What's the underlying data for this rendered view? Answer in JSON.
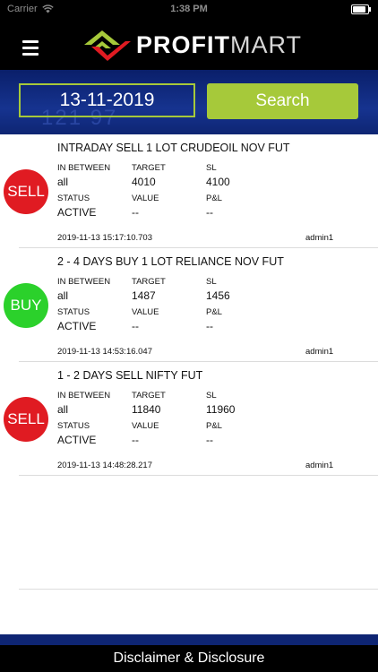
{
  "status_bar": {
    "carrier": "Carrier",
    "time": "1:38 PM",
    "battery_level": 0.9
  },
  "header": {
    "logo": {
      "word_bold": "PROFIT",
      "word_light": "MART"
    }
  },
  "search": {
    "date_value": "13-11-2019",
    "button_label": "Search",
    "background_digits": "121 97"
  },
  "colors": {
    "accent_green": "#a6c93a",
    "sell_red": "#e01b22",
    "buy_green": "#2bd12b",
    "band_blue": "#16338f"
  },
  "calls": [
    {
      "side": "SELL",
      "side_color": "#e01b22",
      "title": "INTRADAY SELL 1 LOT CRUDEOIL NOV FUT",
      "labels": {
        "in_between": "IN BETWEEN",
        "target": "TARGET",
        "sl": "SL",
        "status": "STATUS",
        "value": "VALUE",
        "pnl": "P&L"
      },
      "in_between": "all",
      "target": "4010",
      "sl": "4100",
      "status": "ACTIVE",
      "value": "--",
      "pnl": "--",
      "timestamp": "2019-11-13 15:17:10.703",
      "author": "admin1"
    },
    {
      "side": "BUY",
      "side_color": "#2bd12b",
      "title": "2 - 4 DAYS BUY 1 LOT RELIANCE NOV FUT",
      "labels": {
        "in_between": "IN BETWEEN",
        "target": "TARGET",
        "sl": "SL",
        "status": "STATUS",
        "value": "VALUE",
        "pnl": "P&L"
      },
      "in_between": "all",
      "target": "1487",
      "sl": "1456",
      "status": "ACTIVE",
      "value": "--",
      "pnl": "--",
      "timestamp": "2019-11-13 14:53:16.047",
      "author": "admin1"
    },
    {
      "side": "SELL",
      "side_color": "#e01b22",
      "title": "1 - 2 DAYS SELL NIFTY FUT",
      "labels": {
        "in_between": "IN BETWEEN",
        "target": "TARGET",
        "sl": "SL",
        "status": "STATUS",
        "value": "VALUE",
        "pnl": "P&L"
      },
      "in_between": "all",
      "target": "11840",
      "sl": "11960",
      "status": "ACTIVE",
      "value": "--",
      "pnl": "--",
      "timestamp": "2019-11-13 14:48:28.217",
      "author": "admin1"
    }
  ],
  "footer": {
    "label": "Disclaimer & Disclosure"
  }
}
